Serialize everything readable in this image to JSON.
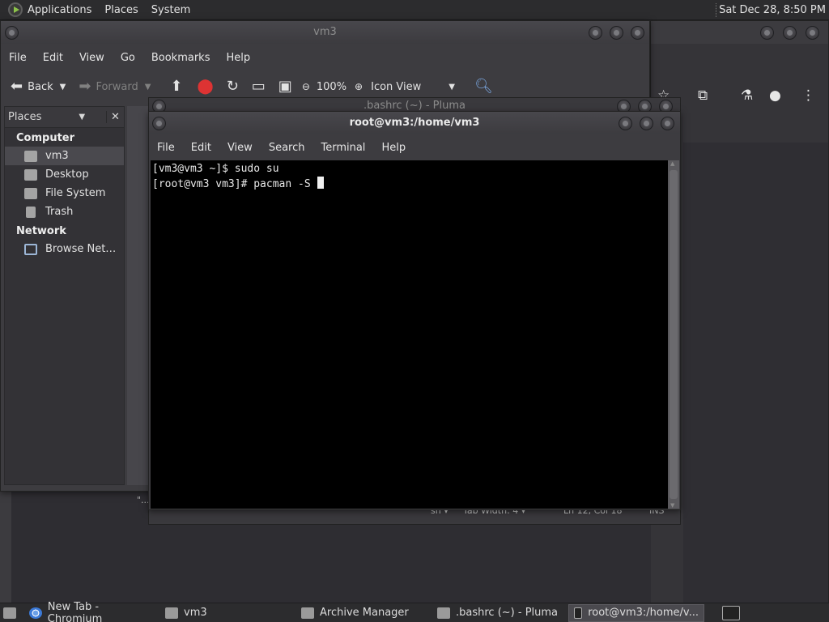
{
  "top_panel": {
    "menus": [
      "Applications",
      "Places",
      "System"
    ],
    "clock": "Sat Dec 28,  8:50 PM"
  },
  "file_manager": {
    "title": "vm3",
    "menu": [
      "File",
      "Edit",
      "View",
      "Go",
      "Bookmarks",
      "Help"
    ],
    "toolbar": {
      "back": "Back",
      "forward": "Forward",
      "zoom": "100%",
      "view_mode": "Icon View"
    },
    "sidebar": {
      "header": "Places",
      "sections": [
        {
          "title": "Computer",
          "items": [
            "vm3",
            "Desktop",
            "File System",
            "Trash"
          ]
        },
        {
          "title": "Network",
          "items": [
            "Browse Net…"
          ]
        }
      ],
      "selected": "vm3"
    },
    "footer_fragment": "\"..."
  },
  "pluma": {
    "title": ".bashrc (~) - Pluma",
    "status": {
      "lang": "sh",
      "tab_width": "Tab Width:  4",
      "position": "Ln 12, Col 18",
      "mode": "INS"
    }
  },
  "terminal": {
    "title": "root@vm3:/home/vm3",
    "menu": [
      "File",
      "Edit",
      "View",
      "Search",
      "Terminal",
      "Help"
    ],
    "lines": [
      "[vm3@vm3 ~]$ sudo su",
      "[root@vm3 vm3]# pacman -S "
    ]
  },
  "chromium": {
    "icons": [
      "star-icon",
      "extension-icon",
      "flask-icon",
      "account-icon",
      "menu-dots-icon"
    ]
  },
  "taskbar": {
    "tasks": [
      {
        "label": "New Tab - Chromium",
        "icon": "chromium-icon"
      },
      {
        "label": "vm3",
        "icon": "folder-icon"
      },
      {
        "label": "Archive Manager",
        "icon": "archive-icon"
      },
      {
        "label": ".bashrc (~) - Pluma",
        "icon": "text-editor-icon"
      },
      {
        "label": "root@vm3:/home/v...",
        "icon": "terminal-icon",
        "active": true
      }
    ]
  }
}
